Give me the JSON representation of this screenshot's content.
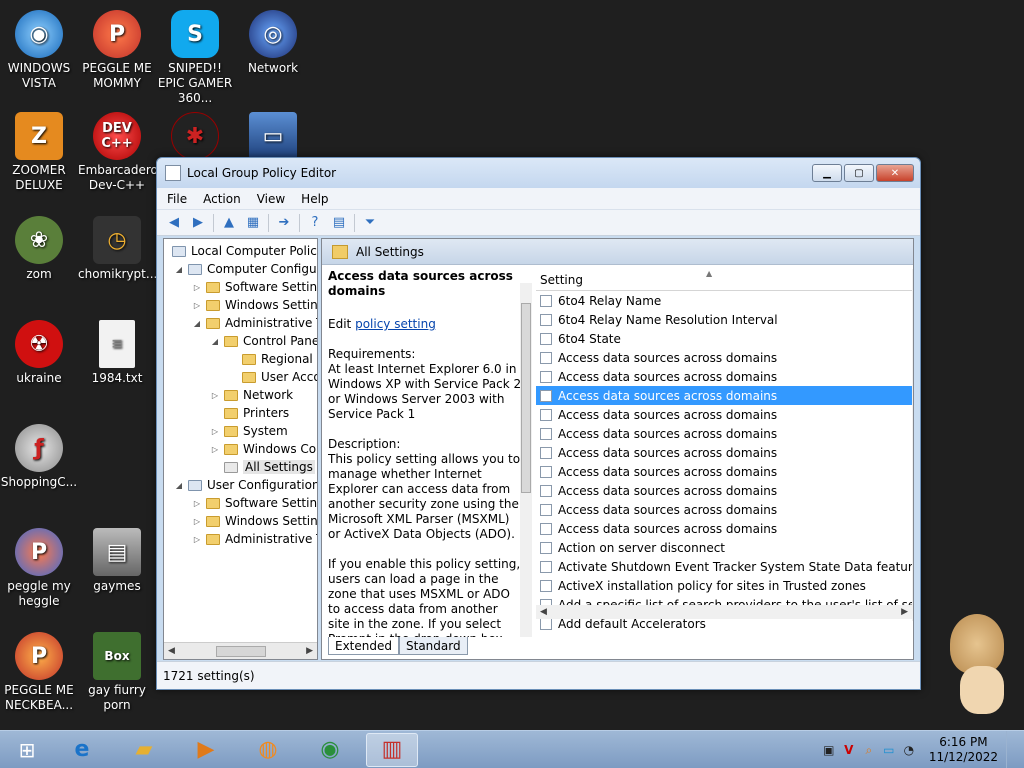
{
  "desktop": {
    "icons": [
      {
        "label": "WINDOWS VISTA"
      },
      {
        "label": "PEGGLE ME MOMMY"
      },
      {
        "label": "SNIPED!! EPIC GAMER 360..."
      },
      {
        "label": "Network"
      },
      {
        "label": "ZOOMER DELUXE"
      },
      {
        "label": "Embarcadero Dev-C++"
      },
      {
        "label": "zom"
      },
      {
        "label": "chomikrypt..."
      },
      {
        "label": "ukraine"
      },
      {
        "label": "1984.txt"
      },
      {
        "label": "ShoppingC..."
      },
      {
        "label": "peggle my heggle"
      },
      {
        "label": "gaymes"
      },
      {
        "label": "PEGGLE ME NECKBEA..."
      },
      {
        "label": "gay fiurry porn"
      }
    ],
    "gaymes_glyph": "Box"
  },
  "window": {
    "title": "Local Group Policy Editor",
    "menu": [
      "File",
      "Action",
      "View",
      "Help"
    ],
    "tree": [
      {
        "label": "Local Computer Policy"
      },
      {
        "label": "Computer Configura"
      },
      {
        "label": "Software Settings"
      },
      {
        "label": "Windows Setting"
      },
      {
        "label": "Administrative Te"
      },
      {
        "label": "Control Panel"
      },
      {
        "label": "Regional a"
      },
      {
        "label": "User Acco"
      },
      {
        "label": "Network"
      },
      {
        "label": "Printers"
      },
      {
        "label": "System"
      },
      {
        "label": "Windows Cor"
      },
      {
        "label": "All Settings"
      },
      {
        "label": "User Configuration"
      },
      {
        "label": "Software Settings"
      },
      {
        "label": "Windows Setting"
      },
      {
        "label": "Administrative Te"
      }
    ],
    "header": "All Settings",
    "description": {
      "title": "Access data sources across domains",
      "edit_prefix": "Edit",
      "edit_link": "policy setting",
      "requirements_label": "Requirements:",
      "requirements_text": "At least Internet Explorer 6.0 in Windows XP with Service Pack 2 or Windows Server 2003 with Service Pack 1",
      "description_label": "Description:",
      "description_text": "This policy setting allows you to manage whether Internet Explorer can access data from another security zone using the Microsoft XML Parser (MSXML) or ActiveX Data Objects (ADO).",
      "more_text": "If you enable this policy setting, users can load a page in the zone that uses MSXML or ADO to access data from another site in the zone. If you select Prompt in the drop-down box, users are queried to choose whether to"
    },
    "list_header": "Setting",
    "rows": [
      "6to4 Relay Name",
      "6to4 Relay Name Resolution Interval",
      "6to4 State",
      "Access data sources across domains",
      "Access data sources across domains",
      "Access data sources across domains",
      "Access data sources across domains",
      "Access data sources across domains",
      "Access data sources across domains",
      "Access data sources across domains",
      "Access data sources across domains",
      "Access data sources across domains",
      "Access data sources across domains",
      "Action on server disconnect",
      "Activate Shutdown Event Tracker System State Data feature",
      "ActiveX installation policy for sites in Trusted zones",
      "Add a specific list of search providers to the user's list of sea...",
      "Add default Accelerators"
    ],
    "selected_row": 5,
    "tabs": [
      "Extended",
      "Standard"
    ],
    "status": "1721 setting(s)"
  },
  "taskbar": {
    "time": "6:16 PM",
    "date": "11/12/2022",
    "pinned": [
      "internet-explorer",
      "file-explorer",
      "media-player",
      "app",
      "chrome",
      "group-policy-editor"
    ]
  },
  "colors": {
    "selection": "#3399ff",
    "link": "#0645ad"
  }
}
